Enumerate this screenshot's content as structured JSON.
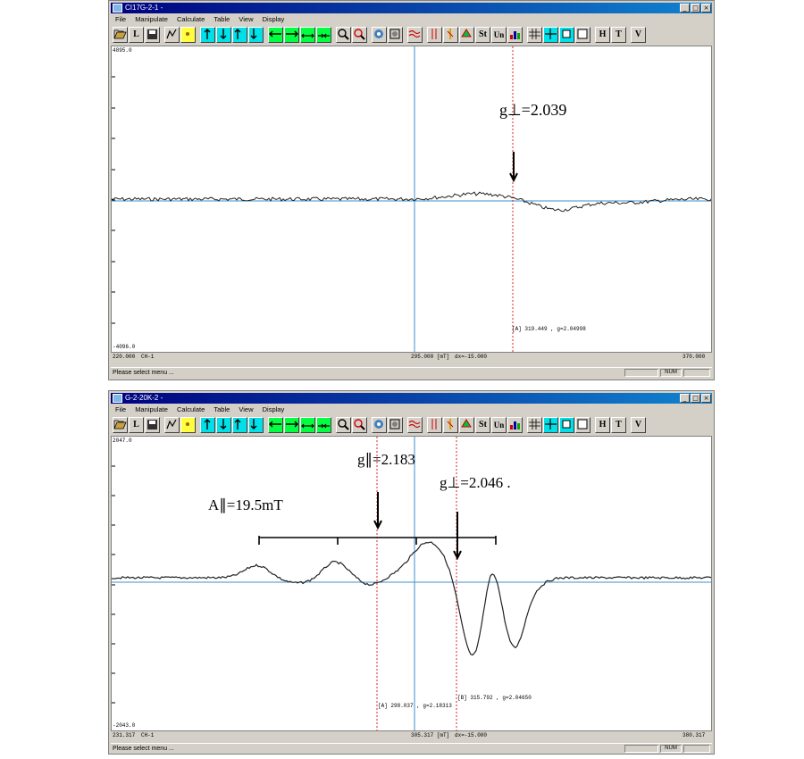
{
  "window1": {
    "title": "CI17G-2-1 -",
    "menu": [
      "File",
      "Manipulate",
      "Calculate",
      "Table",
      "View",
      "Display"
    ],
    "y_top": "4895.0",
    "y_bottom": "-4096.0",
    "x_left": "220.000",
    "channel": "CH-1",
    "x_center": "295.000 [mT]",
    "dx": "dx=-15.000",
    "x_right": "370.000",
    "cursor_label": "[A]  319.449 , g=2.04998",
    "annotation": "g⊥=2.039",
    "status": "Please select menu ...",
    "num": "NUM"
  },
  "window2": {
    "title": "G-2-20K-2 -",
    "menu": [
      "File",
      "Manipulate",
      "Calculate",
      "Table",
      "View",
      "Display"
    ],
    "y_top": "2047.0",
    "y_bottom": "-2043.0",
    "x_left": "231.317",
    "channel": "CH-1",
    "x_center": "305.317 [mT]",
    "dx": "dx=-15.000",
    "x_right": "380.317",
    "cursor_a_label": "[A]  298.037 , g=2.18313",
    "cursor_b_label": "[B]  315.792 , g=2.04650",
    "annotation_gpar": "g∥=2.183",
    "annotation_gperp": "g⊥=2.046 .",
    "annotation_a": "A∥=19.5mT",
    "status": "Please select menu ...",
    "num": "NUM"
  },
  "toolbar_buttons": [
    "open-icon",
    "L",
    "save-icon",
    "curve-icon",
    "yellow-icon",
    "up-icon",
    "down-icon",
    "up-x2-icon",
    "up-x05-icon",
    "left-icon",
    "right-icon",
    "x10-icon",
    "x05-icon",
    "zoom-in-icon",
    "zoom-out-icon",
    "peak-icon",
    "spectrum-icon",
    "wave-icon",
    "cursor-icon",
    "cursor2-icon",
    "peak-mark-icon",
    "St",
    "Un",
    "chart-icon",
    "grid-icon",
    "cross-icon",
    "square-icon",
    "blank-icon",
    "H",
    "T",
    "V"
  ],
  "colors": {
    "title_start": "#000080",
    "title_end": "#1084d0",
    "trace": "#222222",
    "baseline": "#3c8fcc",
    "cursor_red": "#e02020",
    "toolbar_green": "#00ff40",
    "toolbar_cyan": "#00e0e8"
  }
}
